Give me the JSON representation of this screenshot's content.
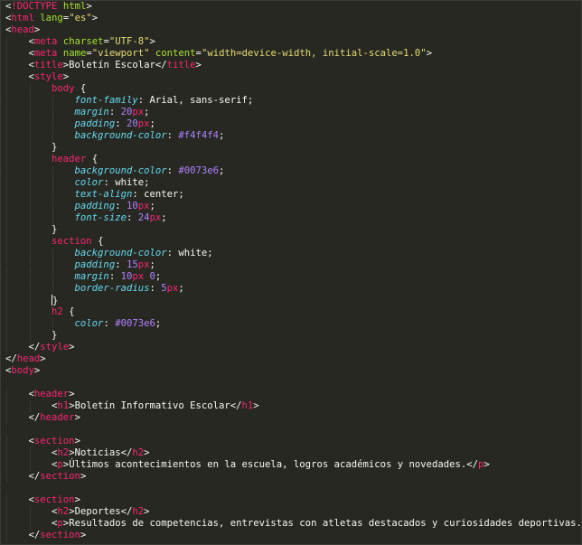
{
  "editor": {
    "colors": {
      "background": "#272822",
      "tag": "#f92672",
      "attribute": "#a6e22e",
      "string": "#e6db74",
      "property": "#66d9ef",
      "number": "#ae81ff",
      "text": "#f8f8f2"
    },
    "lines": [
      {
        "indent": 0,
        "tokens": [
          [
            "pl",
            "<"
          ],
          [
            "tag",
            "!DOCTYPE"
          ],
          [
            "pl",
            " "
          ],
          [
            "attr",
            "html"
          ],
          [
            "pl",
            ">"
          ]
        ]
      },
      {
        "indent": 0,
        "tokens": [
          [
            "pl",
            "<"
          ],
          [
            "tag",
            "html"
          ],
          [
            "pl",
            " "
          ],
          [
            "attr",
            "lang"
          ],
          [
            "pl",
            "="
          ],
          [
            "str",
            "\"es\""
          ],
          [
            "pl",
            ">"
          ]
        ]
      },
      {
        "indent": 0,
        "tokens": [
          [
            "pl",
            "<"
          ],
          [
            "tag",
            "head"
          ],
          [
            "pl",
            ">"
          ]
        ]
      },
      {
        "indent": 1,
        "tokens": [
          [
            "pl",
            "<"
          ],
          [
            "tag",
            "meta"
          ],
          [
            "pl",
            " "
          ],
          [
            "attr",
            "charset"
          ],
          [
            "pl",
            "="
          ],
          [
            "str",
            "\"UTF-8\""
          ],
          [
            "pl",
            ">"
          ]
        ]
      },
      {
        "indent": 1,
        "tokens": [
          [
            "pl",
            "<"
          ],
          [
            "tag",
            "meta"
          ],
          [
            "pl",
            " "
          ],
          [
            "attr",
            "name"
          ],
          [
            "pl",
            "="
          ],
          [
            "str",
            "\"viewport\""
          ],
          [
            "pl",
            " "
          ],
          [
            "attr",
            "content"
          ],
          [
            "pl",
            "="
          ],
          [
            "str",
            "\"width=device-width, initial-scale=1.0\""
          ],
          [
            "pl",
            ">"
          ]
        ]
      },
      {
        "indent": 1,
        "tokens": [
          [
            "pl",
            "<"
          ],
          [
            "tag",
            "title"
          ],
          [
            "pl",
            ">Boletín Escolar</"
          ],
          [
            "tag",
            "title"
          ],
          [
            "pl",
            ">"
          ]
        ]
      },
      {
        "indent": 1,
        "tokens": [
          [
            "pl",
            "<"
          ],
          [
            "tag",
            "style"
          ],
          [
            "pl",
            ">"
          ]
        ]
      },
      {
        "indent": 2,
        "tokens": [
          [
            "tag",
            "body"
          ],
          [
            "pl",
            " {"
          ]
        ]
      },
      {
        "indent": 3,
        "tokens": [
          [
            "prop",
            "font-family"
          ],
          [
            "pl",
            ": Arial, sans-serif;"
          ]
        ]
      },
      {
        "indent": 3,
        "tokens": [
          [
            "prop",
            "margin"
          ],
          [
            "pl",
            ": "
          ],
          [
            "num",
            "20"
          ],
          [
            "tag",
            "px"
          ],
          [
            "pl",
            ";"
          ]
        ]
      },
      {
        "indent": 3,
        "tokens": [
          [
            "prop",
            "padding"
          ],
          [
            "pl",
            ": "
          ],
          [
            "num",
            "20"
          ],
          [
            "tag",
            "px"
          ],
          [
            "pl",
            ";"
          ]
        ]
      },
      {
        "indent": 3,
        "tokens": [
          [
            "prop",
            "background-color"
          ],
          [
            "pl",
            ": "
          ],
          [
            "num",
            "#f4f4f4"
          ],
          [
            "pl",
            ";"
          ]
        ]
      },
      {
        "indent": 2,
        "tokens": [
          [
            "pl",
            "}"
          ]
        ]
      },
      {
        "indent": 2,
        "tokens": [
          [
            "tag",
            "header"
          ],
          [
            "pl",
            " {"
          ]
        ]
      },
      {
        "indent": 3,
        "tokens": [
          [
            "prop",
            "background-color"
          ],
          [
            "pl",
            ": "
          ],
          [
            "num",
            "#0073e6"
          ],
          [
            "pl",
            ";"
          ]
        ]
      },
      {
        "indent": 3,
        "tokens": [
          [
            "prop",
            "color"
          ],
          [
            "pl",
            ": white;"
          ]
        ]
      },
      {
        "indent": 3,
        "tokens": [
          [
            "prop",
            "text-align"
          ],
          [
            "pl",
            ": center;"
          ]
        ]
      },
      {
        "indent": 3,
        "tokens": [
          [
            "prop",
            "padding"
          ],
          [
            "pl",
            ": "
          ],
          [
            "num",
            "10"
          ],
          [
            "tag",
            "px"
          ],
          [
            "pl",
            ";"
          ]
        ]
      },
      {
        "indent": 3,
        "tokens": [
          [
            "prop",
            "font-size"
          ],
          [
            "pl",
            ": "
          ],
          [
            "num",
            "24"
          ],
          [
            "tag",
            "px"
          ],
          [
            "pl",
            ";"
          ]
        ]
      },
      {
        "indent": 2,
        "tokens": [
          [
            "pl",
            "}"
          ]
        ]
      },
      {
        "indent": 2,
        "tokens": [
          [
            "tag",
            "section"
          ],
          [
            "pl",
            " {"
          ]
        ]
      },
      {
        "indent": 3,
        "tokens": [
          [
            "prop",
            "background-color"
          ],
          [
            "pl",
            ": white;"
          ]
        ]
      },
      {
        "indent": 3,
        "tokens": [
          [
            "prop",
            "padding"
          ],
          [
            "pl",
            ": "
          ],
          [
            "num",
            "15"
          ],
          [
            "tag",
            "px"
          ],
          [
            "pl",
            ";"
          ]
        ]
      },
      {
        "indent": 3,
        "tokens": [
          [
            "prop",
            "margin"
          ],
          [
            "pl",
            ": "
          ],
          [
            "num",
            "10"
          ],
          [
            "tag",
            "px"
          ],
          [
            "pl",
            " "
          ],
          [
            "num",
            "0"
          ],
          [
            "pl",
            ";"
          ]
        ]
      },
      {
        "indent": 3,
        "tokens": [
          [
            "prop",
            "border-radius"
          ],
          [
            "pl",
            ": "
          ],
          [
            "num",
            "5"
          ],
          [
            "tag",
            "px"
          ],
          [
            "pl",
            ";"
          ]
        ]
      },
      {
        "indent": 2,
        "tokens": [
          [
            "pl",
            "}"
          ]
        ],
        "caret": true
      },
      {
        "indent": 2,
        "tokens": [
          [
            "tag",
            "h2"
          ],
          [
            "pl",
            " {"
          ]
        ]
      },
      {
        "indent": 3,
        "tokens": [
          [
            "prop",
            "color"
          ],
          [
            "pl",
            ": "
          ],
          [
            "num",
            "#0073e6"
          ],
          [
            "pl",
            ";"
          ]
        ]
      },
      {
        "indent": 2,
        "tokens": [
          [
            "pl",
            "}"
          ]
        ]
      },
      {
        "indent": 1,
        "tokens": [
          [
            "pl",
            "</"
          ],
          [
            "tag",
            "style"
          ],
          [
            "pl",
            ">"
          ]
        ]
      },
      {
        "indent": 0,
        "tokens": [
          [
            "pl",
            "</"
          ],
          [
            "tag",
            "head"
          ],
          [
            "pl",
            ">"
          ]
        ]
      },
      {
        "indent": 0,
        "tokens": [
          [
            "pl",
            "<"
          ],
          [
            "tag",
            "body"
          ],
          [
            "pl",
            ">"
          ]
        ]
      },
      {
        "indent": 0,
        "tokens": []
      },
      {
        "indent": 1,
        "tokens": [
          [
            "pl",
            "<"
          ],
          [
            "tag",
            "header"
          ],
          [
            "pl",
            ">"
          ]
        ]
      },
      {
        "indent": 2,
        "tokens": [
          [
            "pl",
            "<"
          ],
          [
            "tag",
            "h1"
          ],
          [
            "pl",
            ">Boletín Informativo Escolar</"
          ],
          [
            "tag",
            "h1"
          ],
          [
            "pl",
            ">"
          ]
        ]
      },
      {
        "indent": 1,
        "tokens": [
          [
            "pl",
            "</"
          ],
          [
            "tag",
            "header"
          ],
          [
            "pl",
            ">"
          ]
        ]
      },
      {
        "indent": 0,
        "tokens": []
      },
      {
        "indent": 1,
        "tokens": [
          [
            "pl",
            "<"
          ],
          [
            "tag",
            "section"
          ],
          [
            "pl",
            ">"
          ]
        ]
      },
      {
        "indent": 2,
        "tokens": [
          [
            "pl",
            "<"
          ],
          [
            "tag",
            "h2"
          ],
          [
            "pl",
            ">Noticias</"
          ],
          [
            "tag",
            "h2"
          ],
          [
            "pl",
            ">"
          ]
        ]
      },
      {
        "indent": 2,
        "tokens": [
          [
            "pl",
            "<"
          ],
          [
            "tag",
            "p"
          ],
          [
            "pl",
            ">Últimos acontecimientos en la escuela, logros académicos y novedades.</"
          ],
          [
            "tag",
            "p"
          ],
          [
            "pl",
            ">"
          ]
        ]
      },
      {
        "indent": 1,
        "tokens": [
          [
            "pl",
            "</"
          ],
          [
            "tag",
            "section"
          ],
          [
            "pl",
            ">"
          ]
        ]
      },
      {
        "indent": 0,
        "tokens": []
      },
      {
        "indent": 1,
        "tokens": [
          [
            "pl",
            "<"
          ],
          [
            "tag",
            "section"
          ],
          [
            "pl",
            ">"
          ]
        ]
      },
      {
        "indent": 2,
        "tokens": [
          [
            "pl",
            "<"
          ],
          [
            "tag",
            "h2"
          ],
          [
            "pl",
            ">Deportes</"
          ],
          [
            "tag",
            "h2"
          ],
          [
            "pl",
            ">"
          ]
        ]
      },
      {
        "indent": 2,
        "tokens": [
          [
            "pl",
            "<"
          ],
          [
            "tag",
            "p"
          ],
          [
            "pl",
            ">Resultados de competencias, entrevistas con atletas destacados y curiosidades deportivas.</"
          ],
          [
            "tag",
            "p"
          ],
          [
            "pl",
            ">"
          ]
        ]
      },
      {
        "indent": 1,
        "tokens": [
          [
            "pl",
            "</"
          ],
          [
            "tag",
            "section"
          ],
          [
            "pl",
            ">"
          ]
        ]
      }
    ]
  }
}
